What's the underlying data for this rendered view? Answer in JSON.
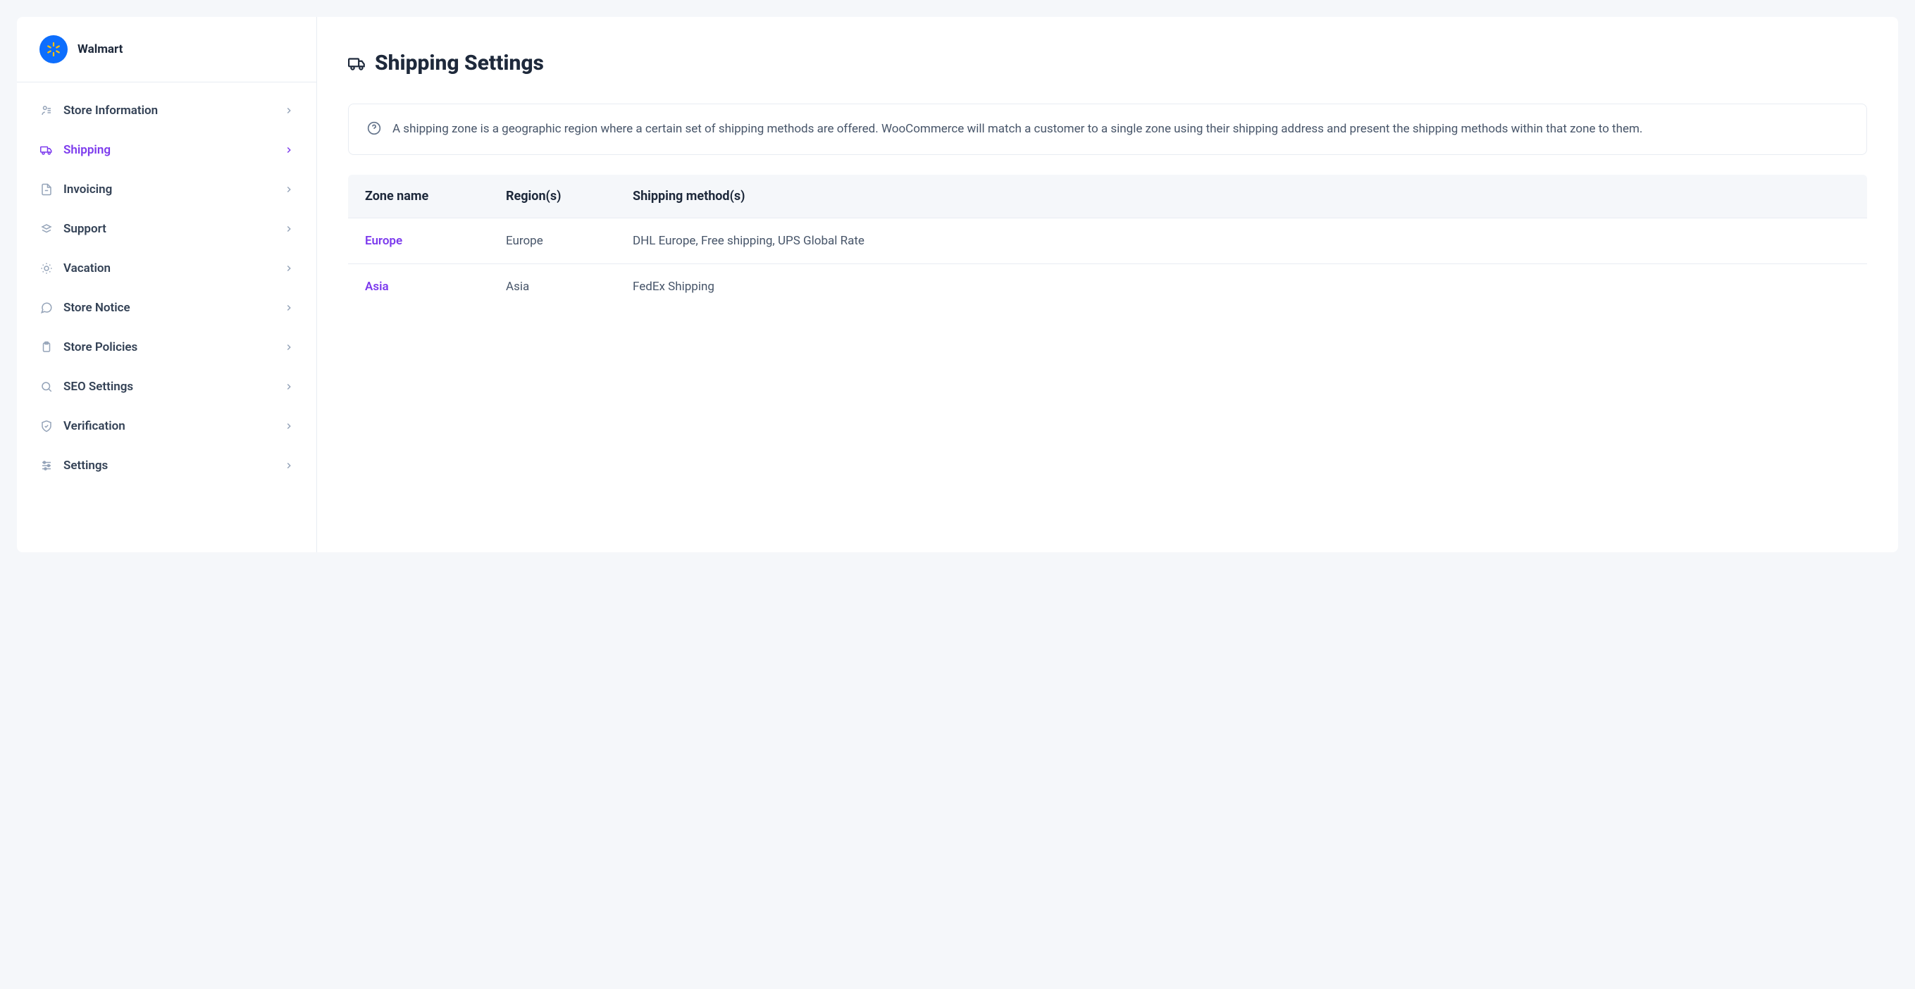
{
  "store": {
    "name": "Walmart"
  },
  "sidebar": {
    "items": [
      {
        "label": "Store Information",
        "active": false
      },
      {
        "label": "Shipping",
        "active": true
      },
      {
        "label": "Invoicing",
        "active": false
      },
      {
        "label": "Support",
        "active": false
      },
      {
        "label": "Vacation",
        "active": false
      },
      {
        "label": "Store Notice",
        "active": false
      },
      {
        "label": "Store Policies",
        "active": false
      },
      {
        "label": "SEO Settings",
        "active": false
      },
      {
        "label": "Verification",
        "active": false
      },
      {
        "label": "Settings",
        "active": false
      }
    ]
  },
  "page": {
    "title": "Shipping Settings",
    "info_text": "A shipping zone is a geographic region where a certain set of shipping methods are offered. WooCommerce will match a customer to a single zone using their shipping address and present the shipping methods within that zone to them."
  },
  "table": {
    "headers": {
      "zone": "Zone name",
      "region": "Region(s)",
      "methods": "Shipping method(s)"
    },
    "rows": [
      {
        "zone": "Europe",
        "region": "Europe",
        "methods": "DHL Europe, Free shipping, UPS Global Rate"
      },
      {
        "zone": "Asia",
        "region": "Asia",
        "methods": "FedEx Shipping"
      }
    ]
  }
}
